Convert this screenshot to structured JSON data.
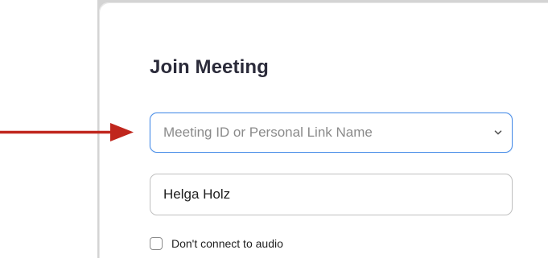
{
  "dialog": {
    "title": "Join Meeting",
    "meeting_field": {
      "value": "",
      "placeholder": "Meeting ID or Personal Link Name",
      "dropdown_icon": "chevron-down-icon"
    },
    "name_field": {
      "value": "Helga Holz",
      "placeholder": ""
    },
    "audio_option": {
      "label": "Don't connect to audio",
      "checked": false
    }
  },
  "annotation": {
    "arrow_color": "#c0261d"
  },
  "colors": {
    "focus_border": "#4a8ee8",
    "title_text": "#2b2b3a"
  }
}
